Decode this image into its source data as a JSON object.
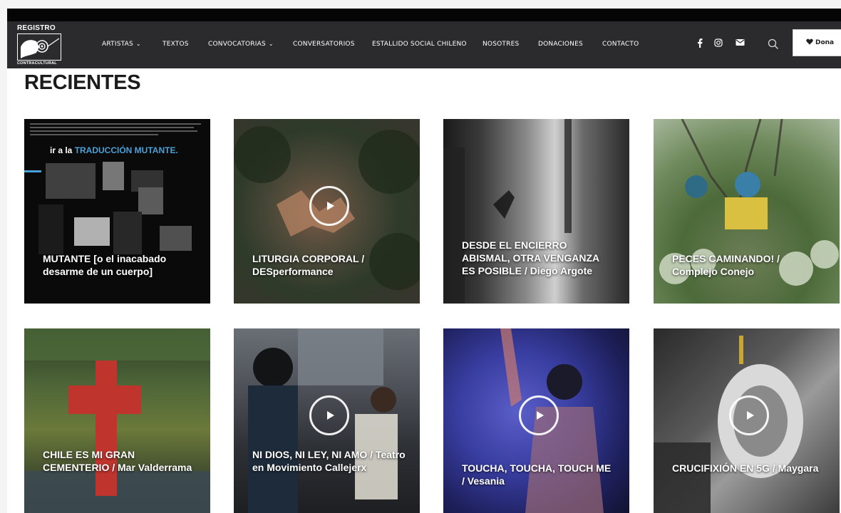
{
  "header": {
    "logo_top": "REGISTRO",
    "logo_bottom": "CONTRACULTURAL",
    "nav": [
      {
        "label": "ARTISTAS",
        "has_caret": true
      },
      {
        "label": "TEXTOS",
        "has_caret": false
      },
      {
        "label": "CONVOCATORIAS",
        "has_caret": true
      },
      {
        "label": "CONVERSATORIOS",
        "has_caret": false
      },
      {
        "label": "ESTALLIDO SOCIAL CHILENO",
        "has_caret": false
      },
      {
        "label": "NOSOTRES",
        "has_caret": false
      },
      {
        "label": "DONACIONES",
        "has_caret": false
      },
      {
        "label": "CONTACTO",
        "has_caret": false
      }
    ],
    "social": [
      "facebook-icon",
      "instagram-icon",
      "mail-icon"
    ],
    "caret_glyph": "⌄",
    "dona_label": "Dona",
    "colors": {
      "bar": "#2b2b2d",
      "top": "#050505"
    }
  },
  "main": {
    "section_title": "RECIENTES",
    "cards": [
      {
        "title": "MUTANTE [o el inacabado desarme de un cuerpo]",
        "has_play": false,
        "overlay_text": "ir a la TRADUCCIÓN MUTANTE.",
        "overlay_accent": "TRADUCCIÓN MUTANTE."
      },
      {
        "title": "LITURGIA CORPORAL / DESperformance",
        "has_play": true
      },
      {
        "title": "DESDE EL ENCIERRO ABISMAL, OTRA VENGANZA ES POSIBLE / Diego Argote",
        "has_play": false
      },
      {
        "title": "PECES CAMINANDO! / Complejo Conejo",
        "has_play": false
      },
      {
        "title": "CHILE ES MI GRAN CEMENTERIO / Mar Valderrama",
        "has_play": false
      },
      {
        "title": "NI DIOS, NI LEY, NI AMO / Teatro en Movimiento Callejerx",
        "has_play": true
      },
      {
        "title": "TOUCHA, TOUCHA, TOUCH ME / Vesania",
        "has_play": true
      },
      {
        "title": "CRUCIFIXIÓN EN 5G / Maygara",
        "has_play": true
      }
    ]
  }
}
